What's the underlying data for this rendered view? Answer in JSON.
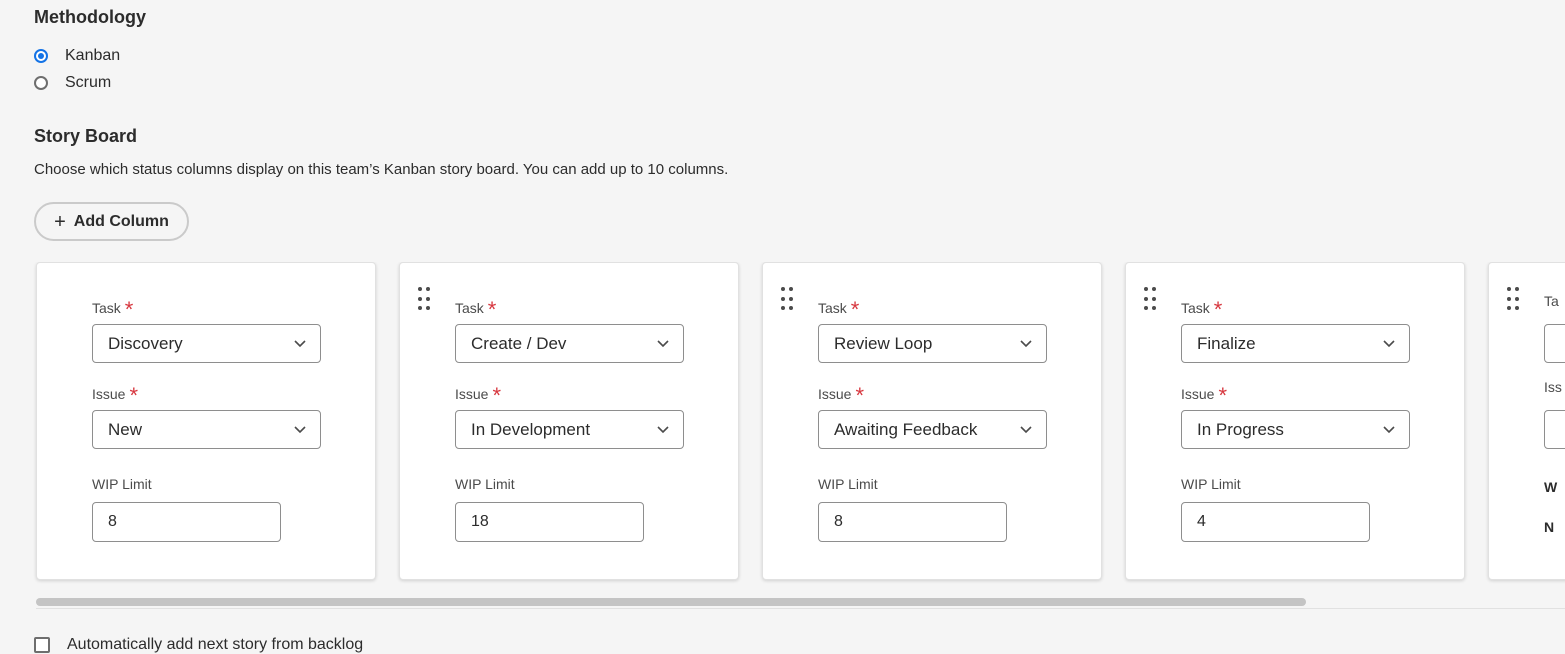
{
  "methodology": {
    "title": "Methodology",
    "options": [
      {
        "label": "Kanban",
        "selected": true
      },
      {
        "label": "Scrum",
        "selected": false
      }
    ]
  },
  "story_board": {
    "title": "Story Board",
    "description": "Choose which status columns display on this team’s Kanban story board. You can add up to 10 columns.",
    "add_column_label": "Add Column"
  },
  "labels": {
    "task": "Task",
    "issue": "Issue",
    "wip_limit": "WIP Limit",
    "required_mark": "*"
  },
  "columns": [
    {
      "task": "Discovery",
      "issue": "New",
      "wip_limit": "8"
    },
    {
      "task": "Create / Dev",
      "issue": "In Development",
      "wip_limit": "18"
    },
    {
      "task": "Review Loop",
      "issue": "Awaiting Feedback",
      "wip_limit": "8"
    },
    {
      "task": "Finalize",
      "issue": "In Progress",
      "wip_limit": "4"
    }
  ],
  "partial_column": {
    "task_label_fragment": "Ta",
    "issue_label_fragment": "Iss",
    "wip_fragment": "W",
    "next_fragment": "N"
  },
  "auto_add": {
    "label": "Automatically add next story from backlog",
    "checked": false
  },
  "colors": {
    "accent": "#1473e6",
    "required": "#d7373f"
  }
}
